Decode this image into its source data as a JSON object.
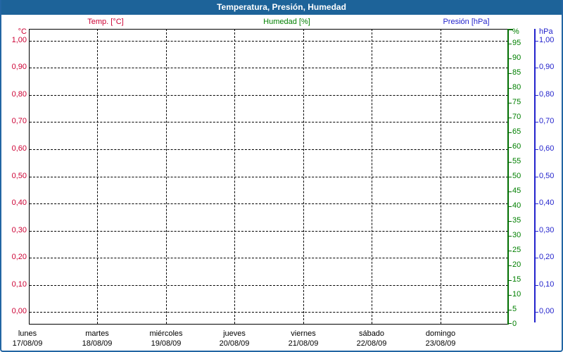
{
  "window": {
    "title": "Temperatura, Presión, Humedad"
  },
  "colors": {
    "titlebar_bg": "#1D6399",
    "window_border": "#2366A3",
    "temp_red": "#CC0033",
    "humidity_green": "#008000",
    "pressure_blue": "#2222CC",
    "grid_black": "#000000"
  },
  "chart_data": {
    "type": "line",
    "title": "Temperatura, Presión, Humedad",
    "grid": true,
    "plot_background": "#FFFFFF",
    "series": [
      {
        "name": "Temp. [°C]",
        "color": "#CC0033",
        "axis": "left",
        "values": []
      },
      {
        "name": "Humedad [%]",
        "color": "#008000",
        "axis": "right-humidity",
        "values": []
      },
      {
        "name": "Presión [hPa]",
        "color": "#2222CC",
        "axis": "right-pressure",
        "values": []
      }
    ],
    "y_axis_left": {
      "unit": "°C",
      "color": "#CC0033",
      "range": [
        0.0,
        1.0
      ],
      "ticks": [
        "1,00",
        "0,90",
        "0,80",
        "0,70",
        "0,60",
        "0,50",
        "0,40",
        "0,30",
        "0,20",
        "0,10",
        "0,00"
      ]
    },
    "y_axis_right_humidity": {
      "unit": "%",
      "color": "#008000",
      "range": [
        0,
        100
      ],
      "ticks": [
        "95",
        "90",
        "85",
        "80",
        "75",
        "70",
        "65",
        "60",
        "55",
        "50",
        "45",
        "40",
        "35",
        "30",
        "25",
        "20",
        "15",
        "10",
        "5",
        "0"
      ]
    },
    "y_axis_right_pressure": {
      "unit": "hPa",
      "color": "#2222CC",
      "range": [
        0.0,
        1.0
      ],
      "ticks": [
        "1,00",
        "0,90",
        "0,80",
        "0,70",
        "0,60",
        "0,50",
        "0,40",
        "0,30",
        "0,20",
        "0,10",
        "0,00"
      ]
    },
    "x_axis": {
      "days": [
        "lunes",
        "martes",
        "miércoles",
        "jueves",
        "viernes",
        "sábado",
        "domingo"
      ],
      "dates": [
        "17/08/09",
        "18/08/09",
        "19/08/09",
        "20/08/09",
        "21/08/09",
        "22/08/09",
        "23/08/09"
      ]
    }
  }
}
